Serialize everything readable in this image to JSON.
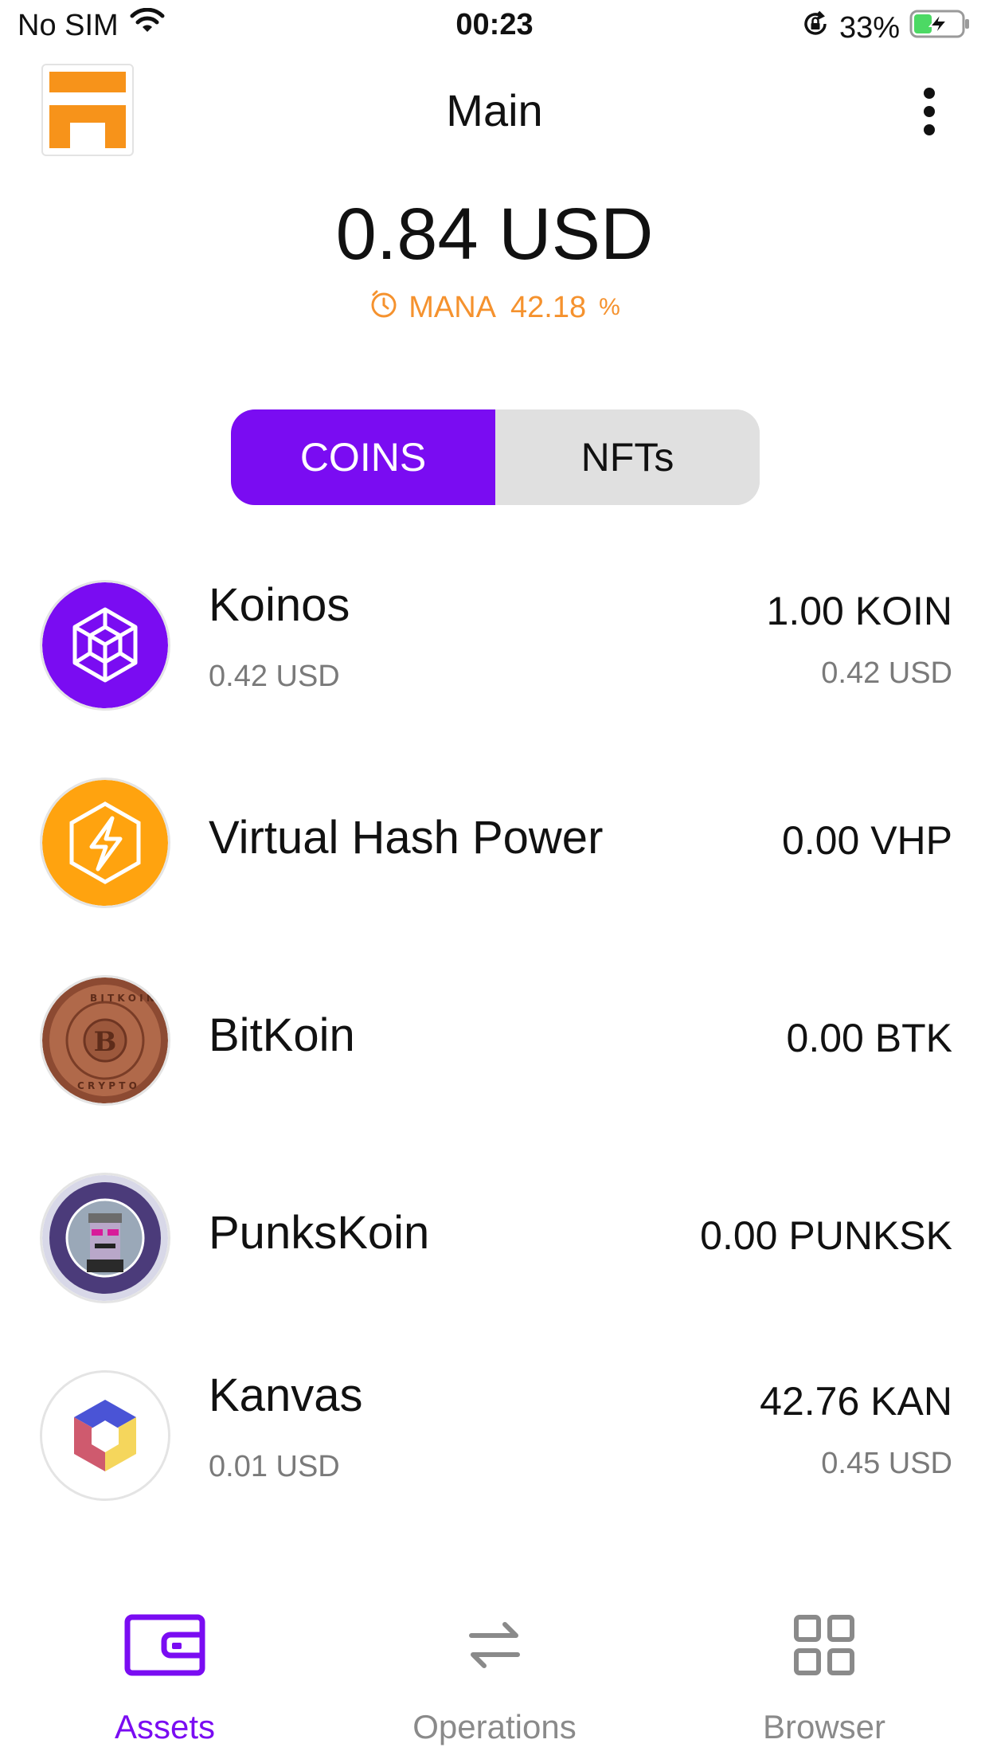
{
  "status_bar": {
    "carrier": "No SIM",
    "time": "00:23",
    "battery_percent": "33%",
    "battery_level": 0.33,
    "icons": [
      "wifi-icon",
      "orientation-lock-icon",
      "battery-charging-icon"
    ]
  },
  "header": {
    "title": "Main",
    "logo_icon": "koinos-logo-icon",
    "menu_icon": "more-vertical-icon"
  },
  "balance": {
    "amount": "0.84 USD"
  },
  "mana": {
    "icon": "timer-icon",
    "label": "MANA",
    "value": "42.18",
    "unit": "%"
  },
  "tabs": {
    "coins": "COINS",
    "nfts": "NFTs",
    "active": "coins"
  },
  "coins": [
    {
      "name": "Koinos",
      "usd_value": "0.42 USD",
      "amount": "1.00 KOIN",
      "amount_usd": "0.42 USD",
      "icon": "koinos-coin-icon"
    },
    {
      "name": "Virtual Hash Power",
      "usd_value": "",
      "amount": "0.00 VHP",
      "amount_usd": "",
      "icon": "vhp-coin-icon"
    },
    {
      "name": "BitKoin",
      "usd_value": "",
      "amount": "0.00 BTK",
      "amount_usd": "",
      "icon": "bitkoin-coin-icon"
    },
    {
      "name": "PunksKoin",
      "usd_value": "",
      "amount": "0.00 PUNKSK",
      "amount_usd": "",
      "icon": "punkskoin-coin-icon"
    },
    {
      "name": "Kanvas",
      "usd_value": "0.01 USD",
      "amount": "42.76 KAN",
      "amount_usd": "0.45 USD",
      "icon": "kanvas-coin-icon"
    }
  ],
  "nav": {
    "assets": "Assets",
    "operations": "Operations",
    "browser": "Browser",
    "active": "assets"
  },
  "colors": {
    "accent": "#7a0cf2",
    "mana": "#f5922e",
    "koinos_bg": "#7a0cf2",
    "vhp_bg": "#ffa30f",
    "bitkoin_bg": "#a45d3f",
    "punkskoin_bg": "#4b3b7a"
  }
}
